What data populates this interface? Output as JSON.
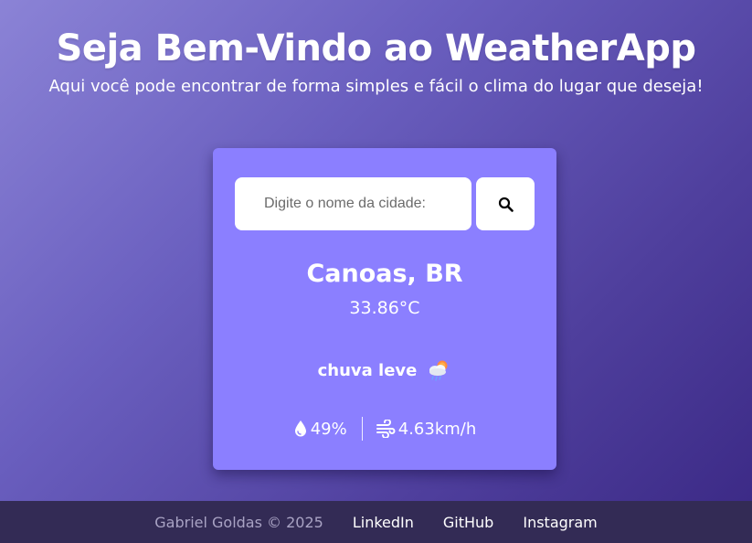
{
  "header": {
    "title": "Seja Bem-Vindo ao WeatherApp",
    "subtitle": "Aqui você pode encontrar de forma simples e fácil o clima do lugar que deseja!"
  },
  "search": {
    "placeholder": "Digite o nome da cidade:",
    "value": "",
    "button_icon": "search-icon"
  },
  "weather": {
    "city": "Canoas, BR",
    "temperature": "33.86°C",
    "description": "chuva leve",
    "condition_icon": "rain-cloud-sun-icon",
    "humidity": "49%",
    "humidity_icon": "water-drop-icon",
    "wind": "4.63km/h",
    "wind_icon": "wind-icon"
  },
  "footer": {
    "copyright": "Gabriel Goldas © 2025",
    "links": [
      "LinkedIn",
      "GitHub",
      "Instagram"
    ]
  },
  "colors": {
    "background_start": "#8b83d6",
    "background_end": "#3a2884",
    "card": "#8b7fff",
    "footer": "#332b55"
  }
}
